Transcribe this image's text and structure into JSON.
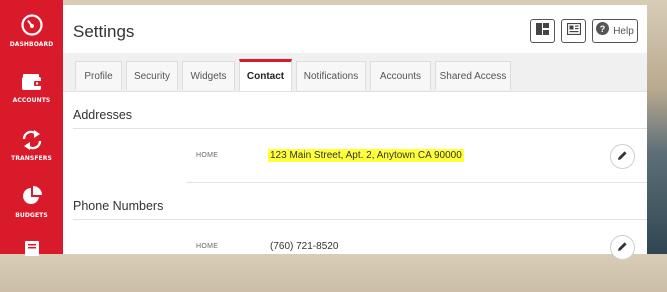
{
  "sidebar": {
    "items": [
      {
        "label": "DASHBOARD",
        "icon": "dashboard-gauge-icon"
      },
      {
        "label": "ACCOUNTS",
        "icon": "wallet-icon"
      },
      {
        "label": "TRANSFERS",
        "icon": "transfer-arrows-icon"
      },
      {
        "label": "BUDGETS",
        "icon": "pie-chart-icon"
      },
      {
        "label": "",
        "icon": "document-list-icon"
      }
    ]
  },
  "header": {
    "title": "Settings",
    "toolbar": [
      {
        "icon": "layout-grid-icon"
      },
      {
        "icon": "newspaper-icon"
      },
      {
        "icon": "question-circle-icon",
        "label": "Help"
      }
    ]
  },
  "tabs": [
    {
      "label": "Profile"
    },
    {
      "label": "Security"
    },
    {
      "label": "Widgets"
    },
    {
      "label": "Contact",
      "active": true
    },
    {
      "label": "Notifications"
    },
    {
      "label": "Accounts"
    },
    {
      "label": "Shared Access"
    }
  ],
  "sections": [
    {
      "title": "Addresses",
      "rows": [
        {
          "label": "HOME",
          "value": "123 Main Street, Apt. 2, Anytown CA 90000",
          "highlighted": true
        }
      ]
    },
    {
      "title": "Phone Numbers",
      "rows": [
        {
          "label": "HOME",
          "value": "(760) 721-8520",
          "highlighted": false
        }
      ]
    }
  ],
  "colors": {
    "accent": "#d91a2a",
    "highlight": "#ffff3a"
  }
}
